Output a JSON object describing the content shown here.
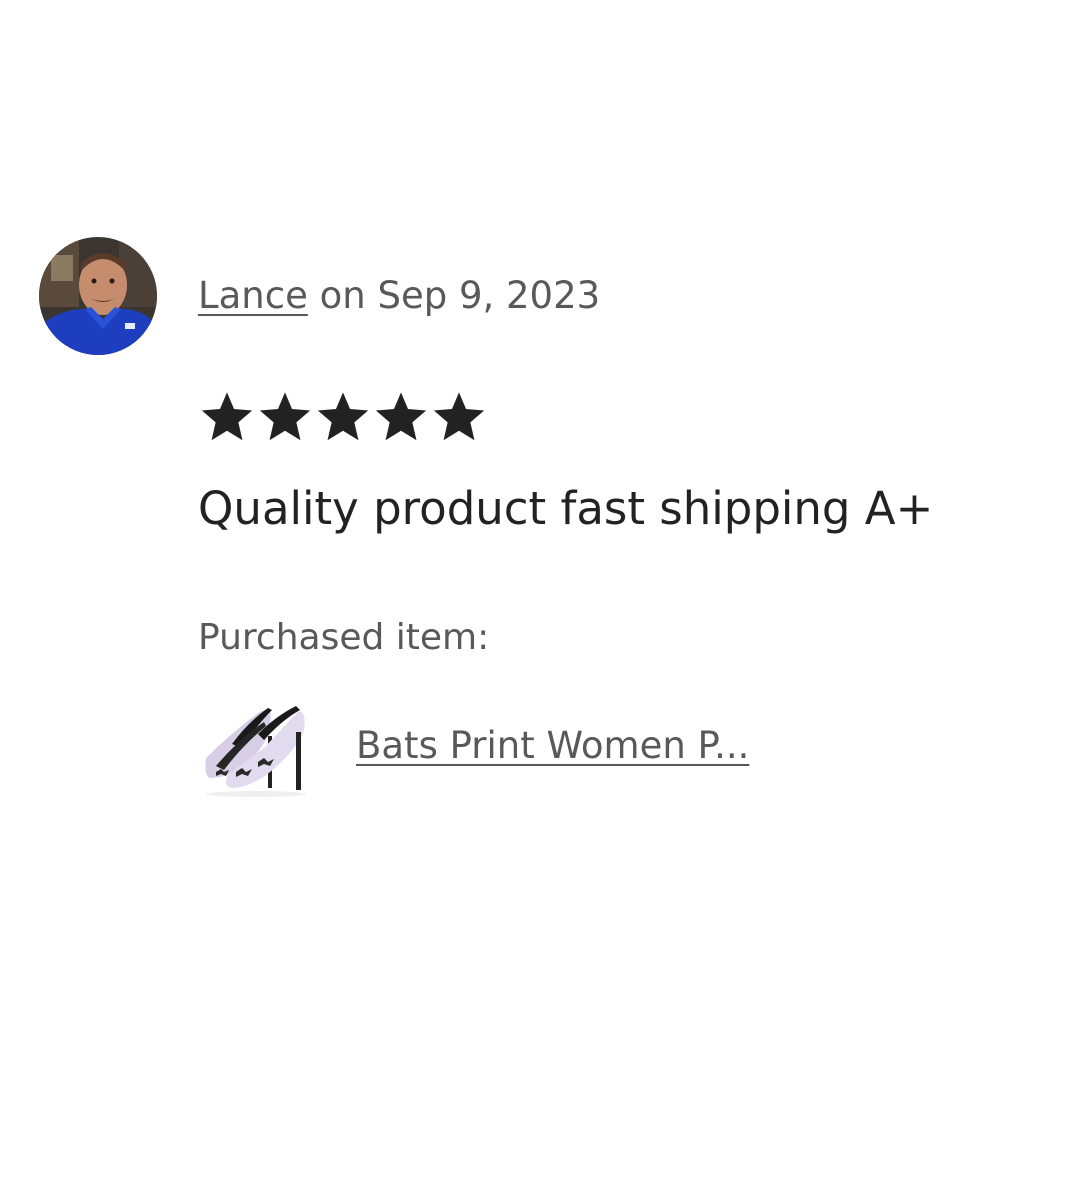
{
  "review": {
    "reviewer_name": "Lance",
    "date_text": " on Sep 9, 2023",
    "rating": 5,
    "rating_max": 5,
    "text": "Quality product fast shipping A+",
    "purchased_label": "Purchased item:",
    "item_title": "Bats Print Women P..."
  },
  "colors": {
    "star": "#222222",
    "muted_text": "#595959",
    "body_text": "#222222",
    "avatar_shirt": "#1d3fbf"
  },
  "icons": {
    "star": "star-icon"
  }
}
